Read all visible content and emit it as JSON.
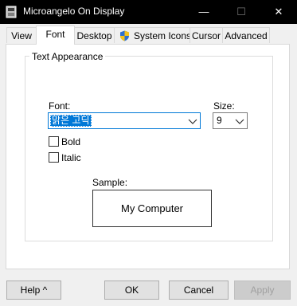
{
  "window": {
    "title": "Microangelo On Display",
    "minimize_glyph": "—",
    "maximize_glyph": "☐",
    "close_glyph": "✕"
  },
  "tabs": [
    {
      "label": "View"
    },
    {
      "label": "Font"
    },
    {
      "label": "Desktop"
    },
    {
      "label": "System Icons"
    },
    {
      "label": "Cursor"
    },
    {
      "label": "Advanced"
    }
  ],
  "text_appearance": {
    "group_title": "Text Appearance",
    "font_label": "Font:",
    "font_value": "맑은 고딕",
    "size_label": "Size:",
    "size_value": "9",
    "bold_label": "Bold",
    "bold_checked": false,
    "italic_label": "Italic",
    "italic_checked": false,
    "sample_label": "Sample:",
    "sample_text": "My Computer"
  },
  "buttons": {
    "help": "Help ^",
    "ok": "OK",
    "cancel": "Cancel",
    "apply": "Apply"
  },
  "colors": {
    "accent": "#0078d7",
    "titlebar": "#000000"
  },
  "icons": {
    "app": "app-icon",
    "shield": "shield-icon",
    "dropdown": "chevron-down-icon"
  }
}
